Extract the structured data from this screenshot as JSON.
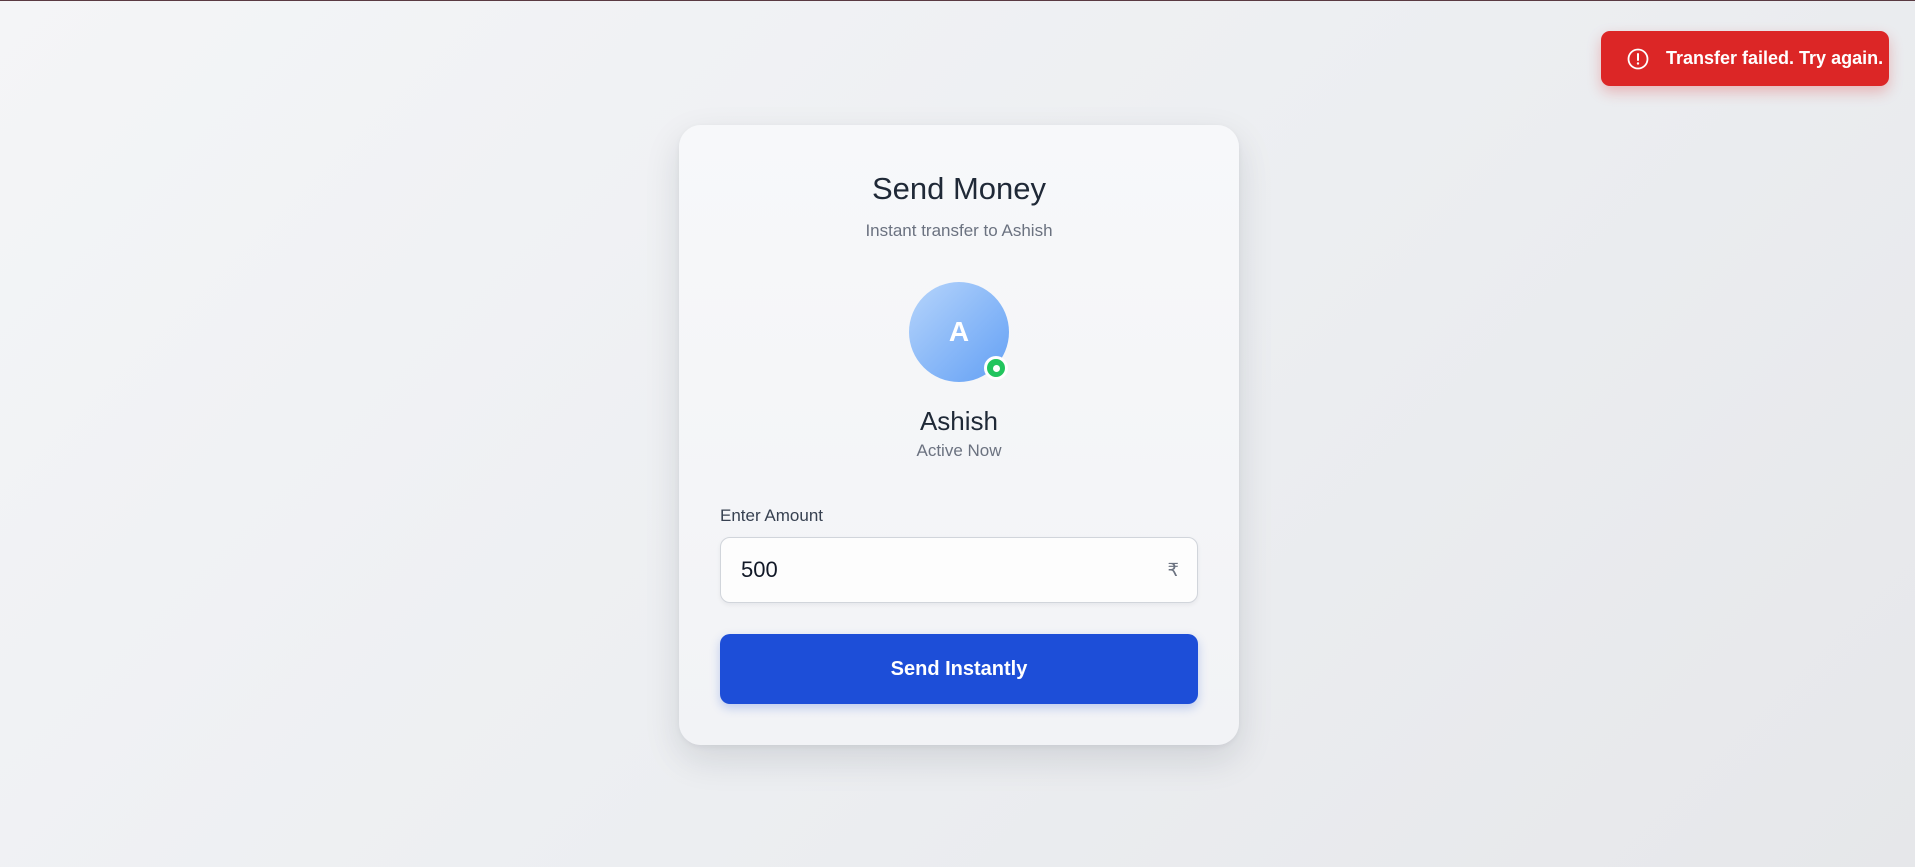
{
  "toast": {
    "icon": "alert-circle-icon",
    "message": "Transfer failed. Try again.",
    "color": "#dc2626"
  },
  "card": {
    "title": "Send Money",
    "subtitle": "Instant transfer to Ashish"
  },
  "recipient": {
    "initial": "A",
    "name": "Ashish",
    "status": "Active Now",
    "status_color": "#22c55e"
  },
  "amount": {
    "label": "Enter Amount",
    "value": "500",
    "currency_symbol": "₹"
  },
  "actions": {
    "send_label": "Send Instantly",
    "send_color": "#1d4ed8"
  }
}
